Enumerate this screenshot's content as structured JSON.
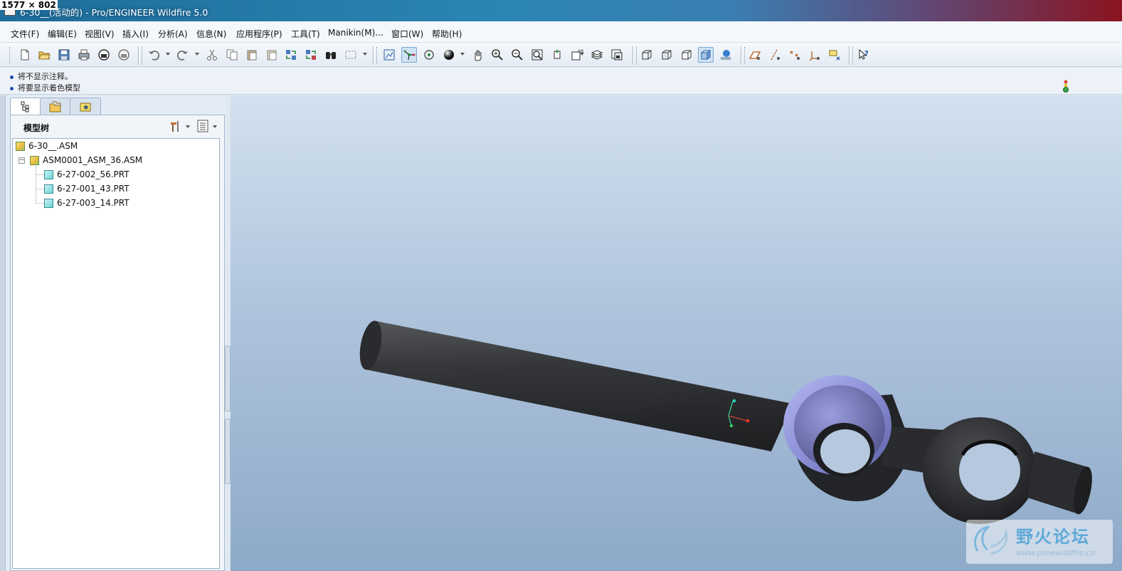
{
  "window": {
    "size_badge": "1577 × 802",
    "title": "6-30__(活动的) - Pro/ENGINEER Wildfire 5.0"
  },
  "menu": {
    "items": [
      "文件(F)",
      "编辑(E)",
      "视图(V)",
      "插入(I)",
      "分析(A)",
      "信息(N)",
      "应用程序(P)",
      "工具(T)",
      "Manikin(M)...",
      "窗口(W)",
      "帮助(H)"
    ]
  },
  "messages": [
    "将不显示注释。",
    "将要显示着色模型"
  ],
  "model_tree": {
    "header": "模型树",
    "items": [
      {
        "label": "6-30__.ASM",
        "type": "asm"
      },
      {
        "label": "ASM0001_ASM_36.ASM",
        "type": "asm",
        "expanded": true
      },
      {
        "label": "6-27-002_56.PRT",
        "type": "prt"
      },
      {
        "label": "6-27-001_43.PRT",
        "type": "prt"
      },
      {
        "label": "6-27-003_14.PRT",
        "type": "prt"
      }
    ]
  },
  "toolbar": {
    "icons": [
      "new-icon",
      "open-icon",
      "save-icon",
      "print-icon",
      "send-mail-icon",
      "send-link-icon",
      "undo-icon",
      "redo-icon",
      "cut-icon",
      "copy-icon",
      "paste-icon",
      "paste-special-icon",
      "regenerate-icon",
      "regen-manager-icon",
      "find-icon",
      "select-box-icon",
      "repaint-icon",
      "spin-center-icon",
      "orient-mode-icon",
      "appearance-icon",
      "pan-icon",
      "zoom-in-icon",
      "zoom-out-icon",
      "refit-icon",
      "reorient-icon",
      "saved-views-icon",
      "layers-icon",
      "view-manager-icon",
      "wireframe-icon",
      "hidden-line-icon",
      "no-hidden-icon",
      "shading-icon",
      "enhanced-realism-icon",
      "datum-planes-icon",
      "datum-axes-icon",
      "datum-points-icon",
      "csys-icon",
      "annotations-icon",
      "context-help-icon"
    ]
  },
  "colors": {
    "accent": "#2b85b5",
    "model_dark": "#2d2e31",
    "model_highlight": "#8b90d6"
  },
  "watermark": {
    "title": "野火论坛",
    "url": "www.proewildfire.cn"
  }
}
